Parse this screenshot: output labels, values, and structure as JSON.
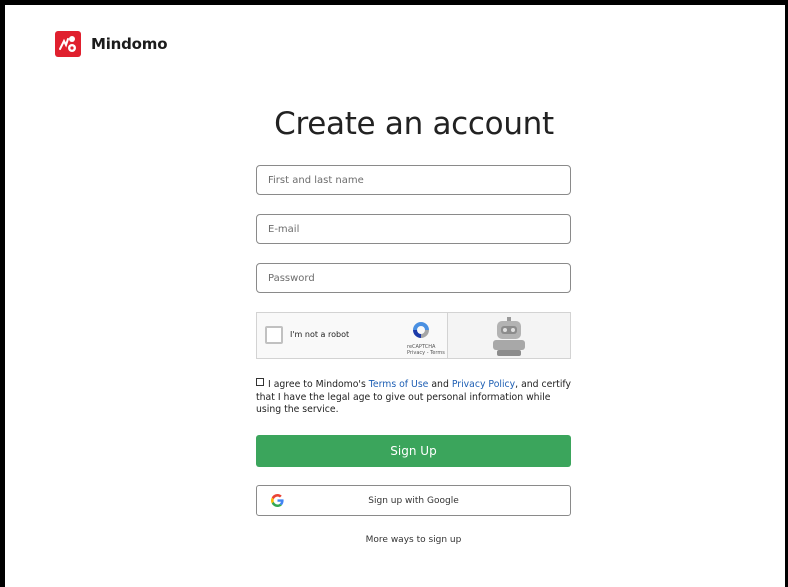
{
  "brand": {
    "name": "Mindomo",
    "color": "#e0202e"
  },
  "form": {
    "title": "Create an account",
    "name_placeholder": "First and last name",
    "email_placeholder": "E-mail",
    "password_placeholder": "Password"
  },
  "recaptcha": {
    "label": "I'm not a robot",
    "brand": "reCAPTCHA",
    "links": "Privacy - Terms"
  },
  "agreement": {
    "text_before": "I agree to Mindomo's ",
    "terms_link": "Terms of Use",
    "text_and": " and ",
    "privacy_link": "Privacy Policy",
    "text_after": ", and certify that I have the legal age to give out personal information while using the service."
  },
  "buttons": {
    "signup": "Sign Up",
    "signup_color": "#3ba55c",
    "google": "Sign up with Google",
    "more": "More ways to sign up"
  },
  "icons": [
    "mindomo-logo-icon",
    "recaptcha-icon",
    "robot-icon",
    "google-icon"
  ]
}
